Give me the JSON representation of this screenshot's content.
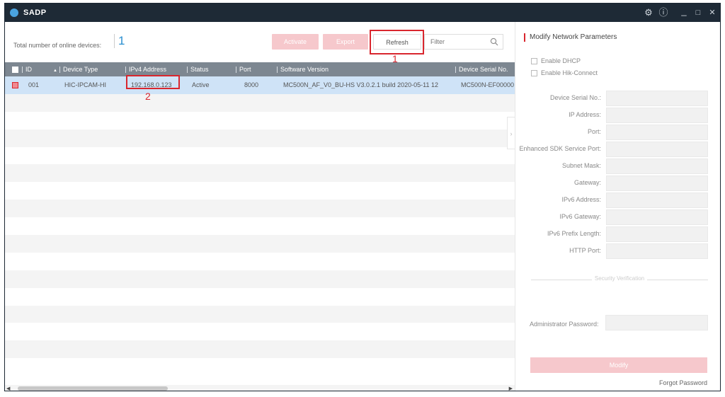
{
  "app": {
    "title": "SADP",
    "controls": {
      "settings": "⚙",
      "info": "ⓘ",
      "minimize": "_",
      "maximize": "□",
      "close": "✕"
    }
  },
  "toolbar": {
    "total_label": "Total number of online devices:",
    "total_count": "1",
    "activate_label": "Activate",
    "export_label": "Export",
    "refresh_label": "Refresh",
    "filter_placeholder": "Filter"
  },
  "annotations": {
    "refresh_marker": "1",
    "ip_marker": "2"
  },
  "table": {
    "columns": [
      "ID",
      "Device Type",
      "IPv4 Address",
      "Status",
      "Port",
      "Software Version",
      "Device Serial No."
    ],
    "sort_arrow": "▲",
    "rows": [
      {
        "id": "001",
        "device_type": "HIC-IPCAM-HI",
        "ipv4": "192.168.0.123",
        "status": "Active",
        "port": "8000",
        "software_version": "MC500N_AF_V0_BU-HS V3.0.2.1 build 2020-05-11 12",
        "serial": "MC500N-EF00000"
      }
    ],
    "empty_rows": 16
  },
  "panel": {
    "title": "Modify Network Parameters",
    "enable_dhcp": "Enable DHCP",
    "enable_hik_connect": "Enable Hik-Connect",
    "fields": [
      "Device Serial No.:",
      "IP Address:",
      "Port:",
      "Enhanced SDK Service Port:",
      "Subnet Mask:",
      "Gateway:",
      "IPv6 Address:",
      "IPv6 Gateway:",
      "IPv6 Prefix Length:",
      "HTTP Port:"
    ],
    "security_verification": "Security Verification",
    "admin_password_label": "Administrator Password:",
    "modify_label": "Modify",
    "forgot_password": "Forgot Password"
  },
  "colors": {
    "titlebar": "#1e2a36",
    "accent": "#d9262e",
    "header": "#7d8791",
    "selected_row": "#cfe3f7",
    "disabled_button": "#f6c8cc"
  },
  "icons": {
    "logo": "sadp-logo-icon",
    "settings": "gear-icon",
    "info": "info-icon",
    "search": "search-icon"
  }
}
